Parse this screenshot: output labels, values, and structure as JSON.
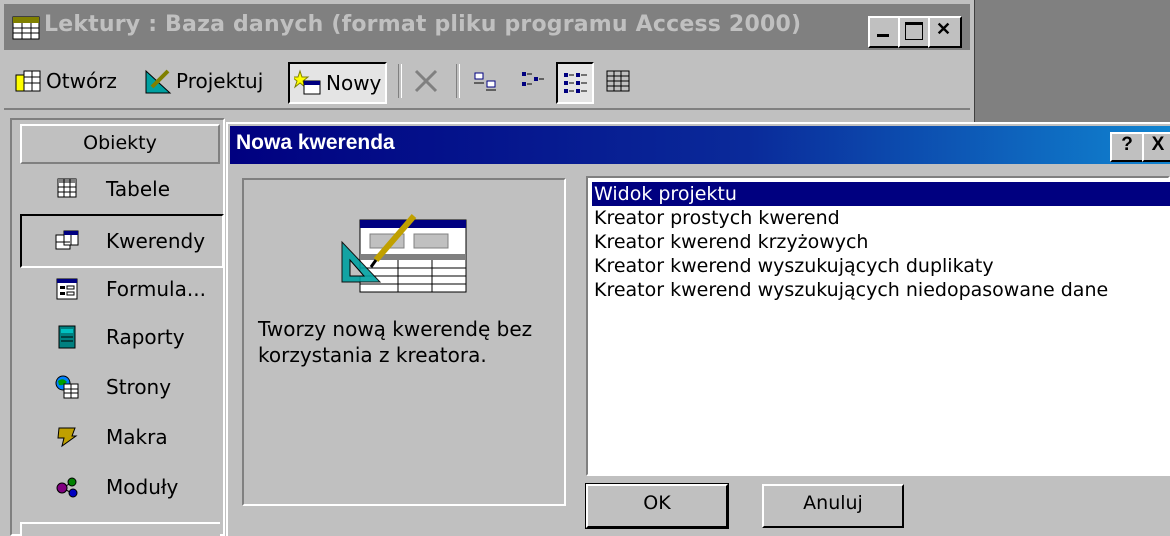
{
  "window": {
    "title": "Lektury : Baza danych (format pliku programu Access 2000)"
  },
  "toolbar": {
    "open_label": "Otwórz",
    "design_label": "Projektuj",
    "new_label": "Nowy"
  },
  "objects": {
    "header": "Obiekty",
    "items": [
      {
        "label": "Tabele",
        "icon": "table-icon"
      },
      {
        "label": "Kwerendy",
        "icon": "query-icon",
        "selected": true
      },
      {
        "label": "Formula...",
        "icon": "form-icon"
      },
      {
        "label": "Raporty",
        "icon": "report-icon"
      },
      {
        "label": "Strony",
        "icon": "page-icon"
      },
      {
        "label": "Makra",
        "icon": "macro-icon"
      },
      {
        "label": "Moduły",
        "icon": "module-icon"
      }
    ]
  },
  "dialog": {
    "title": "Nowa kwerenda",
    "help_label": "?",
    "close_label": "X",
    "description": "Tworzy nową kwerendę bez korzystania z kreatora.",
    "options": [
      "Widok projektu",
      "Kreator prostych kwerend",
      "Kreator kwerend krzyżowych",
      "Kreator kwerend wyszukujących duplikaty",
      "Kreator kwerend wyszukujących niedopasowane dane"
    ],
    "selected_index": 0,
    "ok_label": "OK",
    "cancel_label": "Anuluj"
  },
  "colors": {
    "title_active": "#000080",
    "title_inactive": "#808080",
    "face": "#c0c0c0",
    "selection": "#000080"
  }
}
